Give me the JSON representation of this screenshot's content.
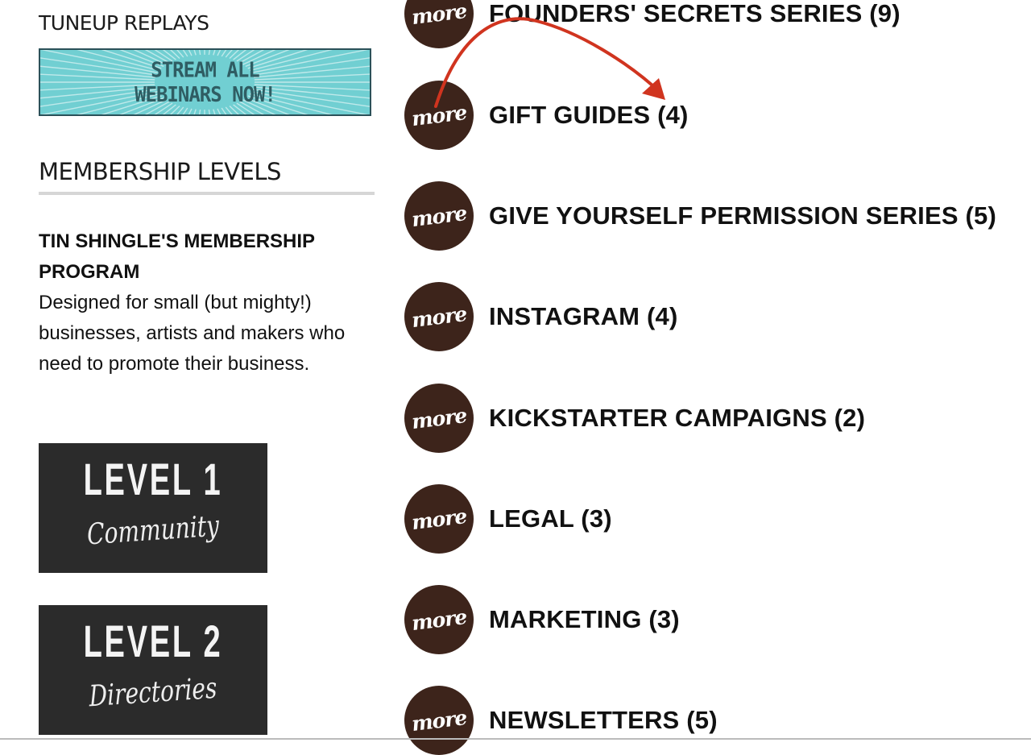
{
  "sidebar": {
    "tuneup_title": "TUNEUP REPLAYS",
    "stream_banner": {
      "line1": "STREAM ALL",
      "line2": "WEBINARS NOW!"
    },
    "membership_title": "MEMBERSHIP LEVELS",
    "program_title": "TIN SHINGLE'S MEMBERSHIP PROGRAM",
    "program_description": "Designed for small (but mighty!) businesses, artists and makers who need to promote their business.",
    "levels": [
      {
        "heading": "LEVEL 1",
        "subtitle": "Community"
      },
      {
        "heading": "LEVEL 2",
        "subtitle": "Directories"
      }
    ]
  },
  "categories": {
    "badge_label": "more",
    "items": [
      {
        "label": "FOUNDERS' SECRETS SERIES (9)"
      },
      {
        "label": "GIFT GUIDES (4)"
      },
      {
        "label": "GIVE YOURSELF PERMISSION SERIES (5)"
      },
      {
        "label": "INSTAGRAM (4)"
      },
      {
        "label": "KICKSTARTER CAMPAIGNS (2)"
      },
      {
        "label": "LEGAL (3)"
      },
      {
        "label": "MARKETING (3)"
      },
      {
        "label": "NEWSLETTERS (5)"
      }
    ]
  },
  "colors": {
    "badge": "#3d241b",
    "banner": "#71cfd2",
    "level_card": "#2b2b2b",
    "annotation_arrow": "#d0341f"
  },
  "icons": {
    "annotation": "curved-arrow-icon"
  }
}
